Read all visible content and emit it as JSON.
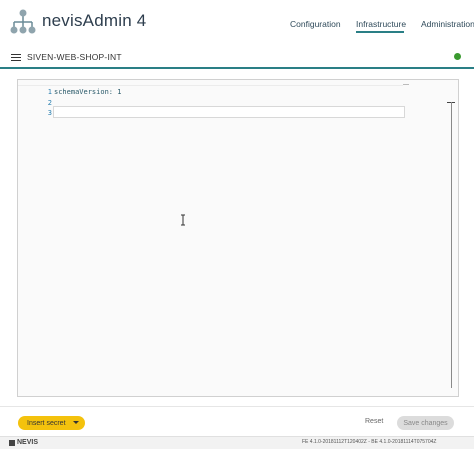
{
  "header": {
    "app_title": "nevisAdmin 4",
    "nav": [
      {
        "label": "Configuration"
      },
      {
        "label": "Infrastructure"
      },
      {
        "label": "Administration"
      }
    ],
    "active_nav": "Infrastructure"
  },
  "subbar": {
    "project_name": "SIVEN-WEB-SHOP-INT",
    "status_color": "#3a9a2f"
  },
  "editor": {
    "line_numbers": [
      "1",
      "2",
      "3"
    ],
    "lines": [
      "schemaVersion: 1",
      "",
      ""
    ]
  },
  "actions": {
    "insert_secret_label": "Insert secret",
    "reset_label": "Reset",
    "save_label": "Save changes"
  },
  "footer": {
    "brand": "NEVIS",
    "version": "FE 4.1.0-20181112T120402Z - BE 4.1.0-20181114T075704Z"
  },
  "colors": {
    "accent": "#2a7f86",
    "insert_secret_bg": "#f4c20d"
  }
}
